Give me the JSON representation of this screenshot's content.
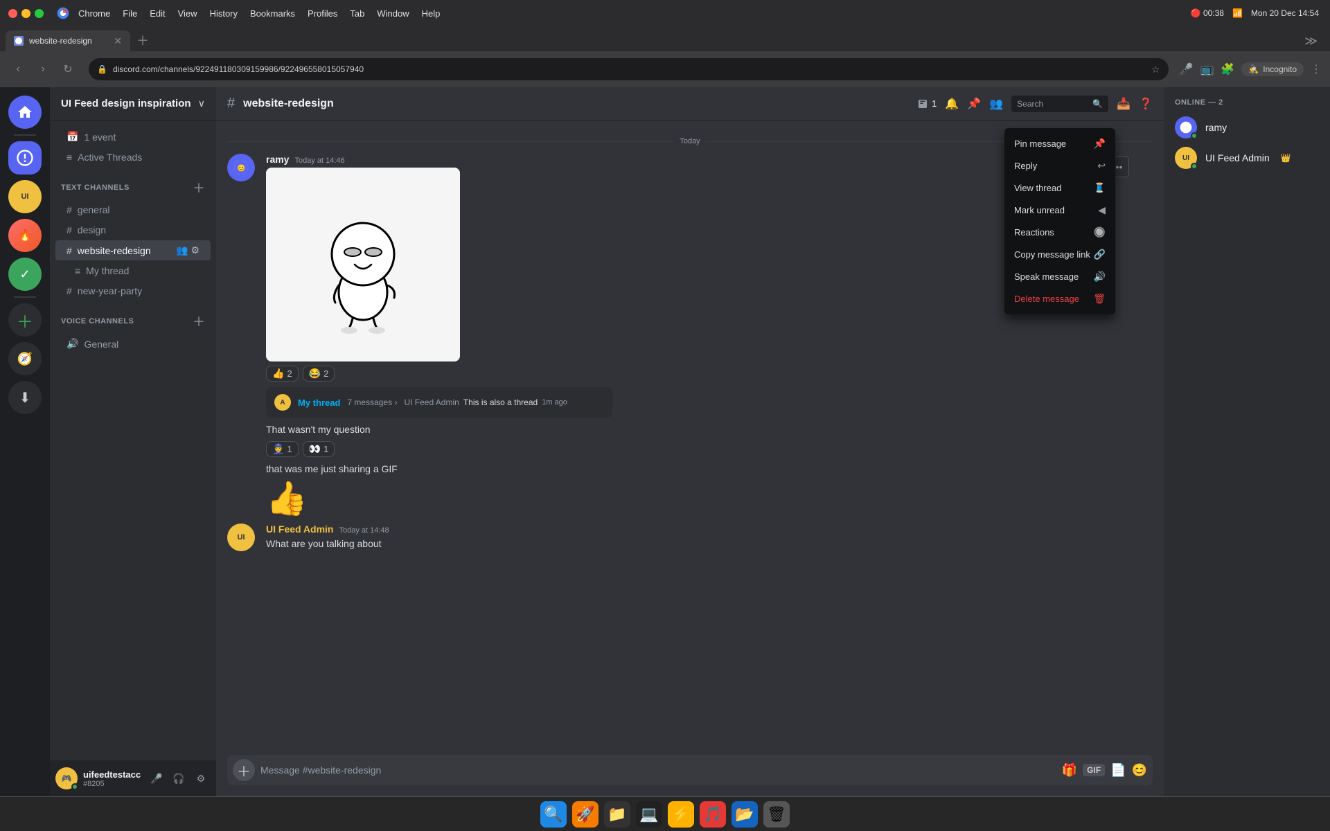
{
  "macos": {
    "time": "Mon 20 Dec  14:54",
    "battery": "00:38"
  },
  "browser": {
    "tab_title": "website-redesign",
    "url": "discord.com/channels/922491180309159986/922496558015057940",
    "nav_back": "←",
    "nav_forward": "→",
    "nav_reload": "↻",
    "profile": "Incognito"
  },
  "discord": {
    "server_name": "UI Feed design inspiration",
    "channel": "website-redesign",
    "channel_hash": "#",
    "member_count": "1",
    "online_count": "2",
    "user": {
      "name": "uifeedtestacc",
      "tag": "#8205"
    },
    "channels": {
      "text_section": "TEXT CHANNELS",
      "voice_section": "VOICE CHANNELS",
      "items": [
        {
          "name": "1 event",
          "type": "event",
          "icon": "📅"
        },
        {
          "name": "Active Threads",
          "type": "thread-list",
          "icon": "≡"
        },
        {
          "name": "general",
          "type": "text",
          "active": false
        },
        {
          "name": "design",
          "type": "text",
          "active": false
        },
        {
          "name": "website-redesign",
          "type": "text",
          "active": true
        },
        {
          "name": "My thread",
          "type": "thread",
          "active": false
        },
        {
          "name": "new-year-party",
          "type": "text",
          "active": false
        },
        {
          "name": "General",
          "type": "voice",
          "active": false
        }
      ]
    },
    "messages": [
      {
        "id": "msg1",
        "author": "ramy",
        "author_type": "user",
        "time": "Today at 14:46",
        "has_image": true,
        "reactions": [
          {
            "emoji": "👍",
            "count": "2"
          },
          {
            "emoji": "😂",
            "count": "2"
          }
        ],
        "thread": {
          "name": "My thread",
          "count": "7 messages",
          "preview_author": "UI Feed Admin",
          "preview_text": "This is also a thread",
          "time": "1m ago"
        }
      },
      {
        "id": "msg2",
        "author": "ramy",
        "author_type": "user",
        "time": "",
        "text": "That wasn't my question",
        "reactions": [
          {
            "emoji": "👮",
            "count": "1"
          },
          {
            "emoji": "👀",
            "count": "1"
          }
        ]
      },
      {
        "id": "msg3",
        "author": "ramy",
        "author_type": "user",
        "time": "",
        "text": "that was me just sharing a GIF",
        "big_emoji": "👍"
      },
      {
        "id": "msg4",
        "author": "UI Feed Admin",
        "author_type": "admin",
        "time": "Today at 14:48",
        "text": "What are you talking about"
      }
    ],
    "members": [
      {
        "name": "ramy",
        "type": "user",
        "status": "online"
      },
      {
        "name": "UI Feed Admin",
        "type": "admin",
        "status": "online",
        "crown": "👑"
      }
    ],
    "input_placeholder": "Message #website-redesign",
    "online_label": "ONLINE — 2"
  },
  "context_menu": {
    "items": [
      {
        "label": "Pin message",
        "icon": "📌",
        "type": "normal"
      },
      {
        "label": "Reply",
        "icon": "↩",
        "type": "normal"
      },
      {
        "label": "View thread",
        "icon": "🧵",
        "type": "normal"
      },
      {
        "label": "Mark unread",
        "icon": "◀",
        "type": "normal"
      },
      {
        "label": "Reactions",
        "icon": "🔘",
        "type": "normal"
      },
      {
        "label": "Copy message link",
        "icon": "🔗",
        "type": "normal"
      },
      {
        "label": "Speak message",
        "icon": "🔊",
        "type": "normal"
      },
      {
        "label": "Delete message",
        "icon": "🗑",
        "type": "danger"
      }
    ]
  }
}
